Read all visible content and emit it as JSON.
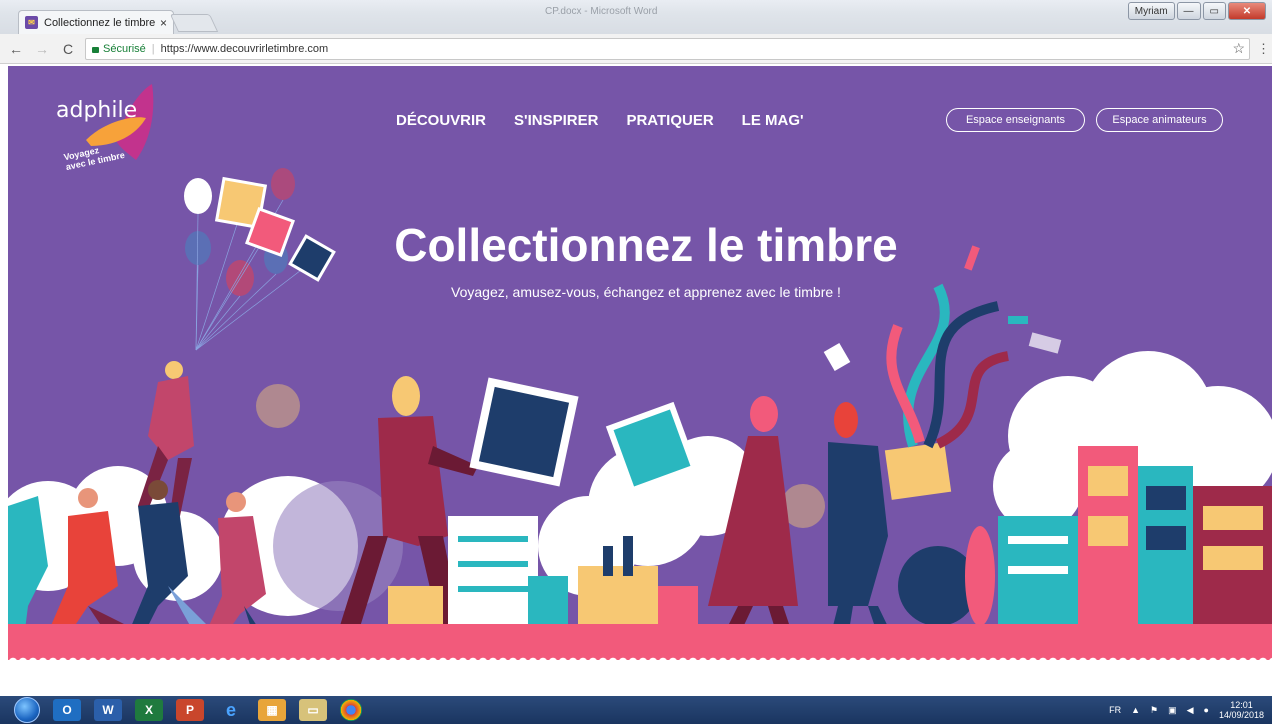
{
  "browser": {
    "tab_title": "Collectionnez le timbre -",
    "tab_close": "×",
    "window_title": "CP.docx - Microsoft Word",
    "user_button": "Myriam",
    "secure_label": "Sécurisé",
    "url": "https://www.decouvrirletimbre.com"
  },
  "site": {
    "logo_text": "adphile",
    "logo_tagline_line1": "Voyagez",
    "logo_tagline_line2": "avec le timbre",
    "nav": [
      "DÉCOUVRIR",
      "S'INSPIRER",
      "PRATIQUER",
      "LE MAG'"
    ],
    "buttons": {
      "teachers": "Espace enseignants",
      "animators": "Espace animateurs"
    },
    "hero": {
      "title": "Collectionnez le timbre",
      "subtitle": "Voyagez, amusez-vous, échangez et apprenez avec le timbre !"
    },
    "colors": {
      "background": "#7655a8",
      "accent_pink": "#f25a7b",
      "accent_yellow": "#f7c873",
      "accent_teal": "#2ab7bf",
      "accent_navy": "#1e3d6b"
    }
  },
  "taskbar": {
    "apps": [
      "outlook-icon",
      "word-icon",
      "excel-icon",
      "powerpoint-icon",
      "ie-icon",
      "photo-icon",
      "explorer-icon",
      "chrome-icon"
    ],
    "language": "FR",
    "time": "12:01",
    "date": "14/09/2018"
  }
}
